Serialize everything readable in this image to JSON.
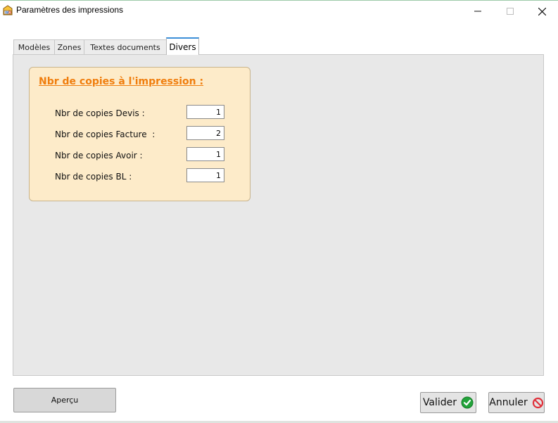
{
  "window": {
    "title": "Paramètres des impressions",
    "app_icon": "wd-app-icon"
  },
  "tabs": [
    {
      "label": "Modèles",
      "active": false
    },
    {
      "label": "Zones",
      "active": false
    },
    {
      "label": "Textes documents",
      "active": false
    },
    {
      "label": "Divers",
      "active": true
    }
  ],
  "group": {
    "title": "Nbr de copies à l'impression :",
    "rows": [
      {
        "label": "Nbr de copies Devis :",
        "value": "1"
      },
      {
        "label": "Nbr de copies Facture  :",
        "value": "2"
      },
      {
        "label": "Nbr de copies Avoir :",
        "value": "1"
      },
      {
        "label": "Nbr de copies BL :",
        "value": "1"
      }
    ]
  },
  "buttons": {
    "apercu": "Aperçu",
    "valider": "Valider",
    "annuler": "Annuler"
  },
  "colors": {
    "group_title": "#f07e0e",
    "group_bg": "#fdebc9",
    "panel_bg": "#e8e8e8",
    "valider_icon": "#22a33a",
    "annuler_icon": "#e0303a"
  }
}
